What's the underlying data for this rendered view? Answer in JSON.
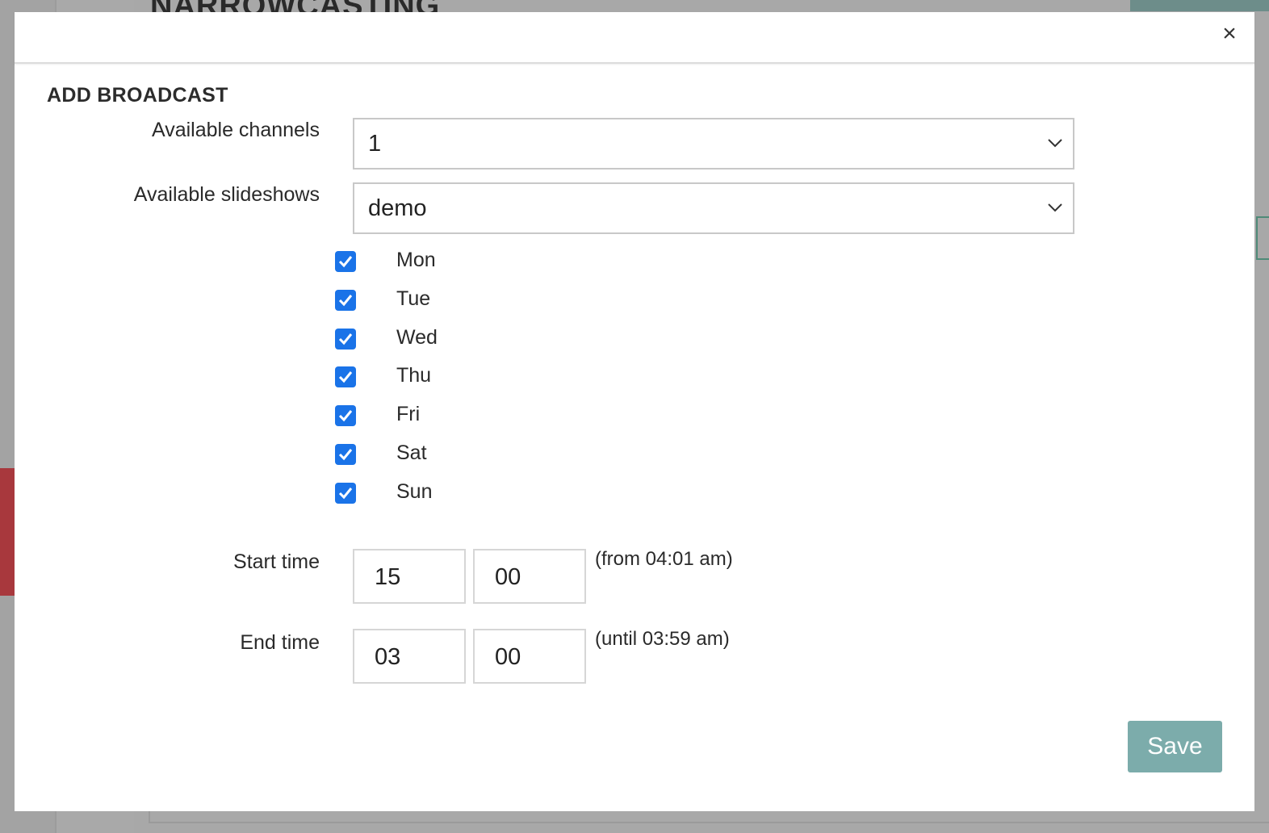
{
  "background": {
    "page_title": "NARROWCASTING"
  },
  "modal": {
    "close_symbol": "×",
    "title": "ADD BROADCAST",
    "channels": {
      "label": "Available channels",
      "value": "1"
    },
    "slideshows": {
      "label": "Available slideshows",
      "value": "demo"
    },
    "days": [
      {
        "label": "Mon",
        "checked": true
      },
      {
        "label": "Tue",
        "checked": true
      },
      {
        "label": "Wed",
        "checked": true
      },
      {
        "label": "Thu",
        "checked": true
      },
      {
        "label": "Fri",
        "checked": true
      },
      {
        "label": "Sat",
        "checked": true
      },
      {
        "label": "Sun",
        "checked": true
      }
    ],
    "start_time": {
      "label": "Start time",
      "hours": "15",
      "minutes": "00",
      "hint": "(from 04:01 am)"
    },
    "end_time": {
      "label": "End time",
      "hours": "03",
      "minutes": "00",
      "hint": "(until 03:59 am)"
    },
    "save_label": "Save"
  },
  "colors": {
    "checkbox": "#1a73e8",
    "save_button": "#7cacab",
    "overlay": "#a6a6a6"
  }
}
